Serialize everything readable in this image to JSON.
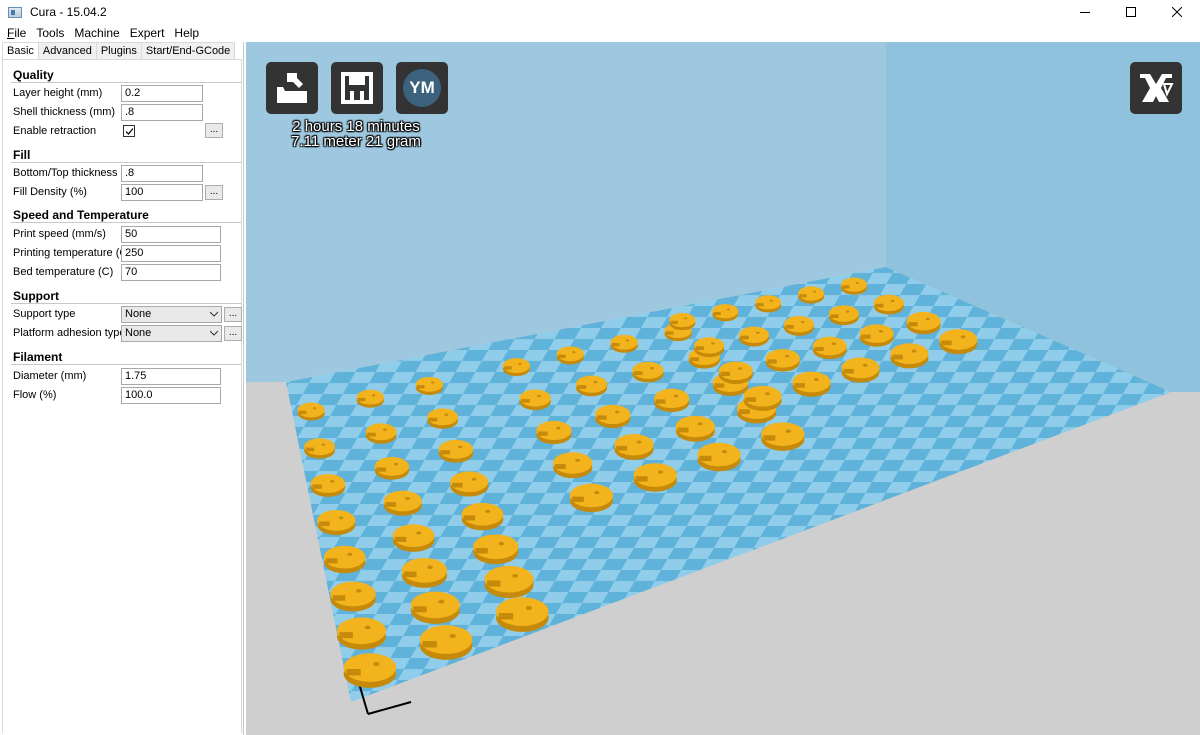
{
  "window": {
    "title": "Cura - 15.04.2"
  },
  "menu": [
    {
      "label": "File",
      "underline": "F",
      "rest": "ile"
    },
    {
      "label": "Tools",
      "underline": "",
      "rest": "Tools"
    },
    {
      "label": "Machine",
      "underline": "",
      "rest": "Machine"
    },
    {
      "label": "Expert",
      "underline": "",
      "rest": "Expert"
    },
    {
      "label": "Help",
      "underline": "",
      "rest": "Help"
    }
  ],
  "tabs": [
    "Basic",
    "Advanced",
    "Plugins",
    "Start/End-GCode"
  ],
  "quality": {
    "title": "Quality",
    "layer_height_label": "Layer height (mm)",
    "layer_height": "0.2",
    "shell_thickness_label": "Shell thickness (mm)",
    "shell_thickness": ".8",
    "enable_retraction_label": "Enable retraction",
    "enable_retraction": true
  },
  "fill": {
    "title": "Fill",
    "bottom_top_label": "Bottom/Top thickness (mm)",
    "bottom_top": ".8",
    "density_label": "Fill Density (%)",
    "density": "100"
  },
  "speed": {
    "title": "Speed and Temperature",
    "print_speed_label": "Print speed (mm/s)",
    "print_speed": "50",
    "print_temp_label": "Printing temperature (C)",
    "print_temp": "250",
    "bed_temp_label": "Bed temperature (C)",
    "bed_temp": "70"
  },
  "support": {
    "title": "Support",
    "type_label": "Support type",
    "type": "None",
    "adhesion_label": "Platform adhesion type",
    "adhesion": "None"
  },
  "filament": {
    "title": "Filament",
    "diameter_label": "Diameter (mm)",
    "diameter": "1.75",
    "flow_label": "Flow (%)",
    "flow": "100.0"
  },
  "dots_label": "...",
  "estimate": {
    "time": "2 hours 18 minutes",
    "material": "7.11 meter 21 gram"
  },
  "buttons": {
    "ym_label": "YM"
  },
  "colors": {
    "part": "#f2b31c",
    "part_shadow": "#c68a0a",
    "bed_light": "#8fcdea",
    "bed_dark": "#5fb2d9",
    "wall": "#99c6e0"
  }
}
